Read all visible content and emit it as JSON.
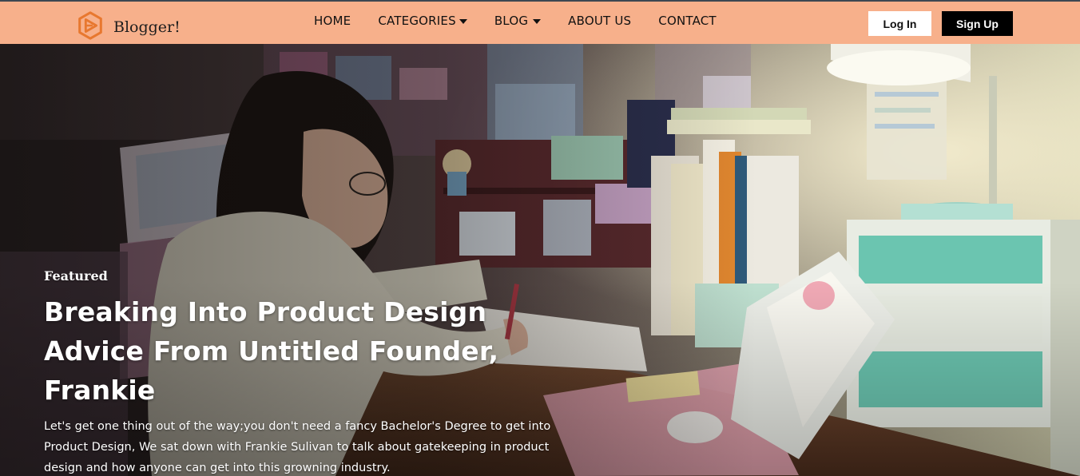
{
  "brand": {
    "name": "Blogger!",
    "logo_icon": "play-circle-logo-icon",
    "logo_color": "#e8782f"
  },
  "nav": {
    "items": [
      {
        "label": "HOME",
        "has_dropdown": false
      },
      {
        "label": "CATEGORIES",
        "has_dropdown": true
      },
      {
        "label": "BLOG",
        "has_dropdown": true
      },
      {
        "label": "ABOUT US",
        "has_dropdown": false
      },
      {
        "label": "CONTACT",
        "has_dropdown": false
      }
    ],
    "background": "#f7b08b"
  },
  "auth": {
    "login_label": "Log In",
    "signup_label": "Sign Up"
  },
  "hero": {
    "featured_label": "Featured",
    "title_line1": "Breaking Into Product Design",
    "title_line2": "Advice From Untitled Founder, Frankie",
    "description": "Let's get one thing out of the way;you don't need a fancy Bachelor's Degree to get into Product Design, We sat down with Frankie Sulivan to talk about gatekeeping in product design and how anyone can get into this growning industry."
  }
}
